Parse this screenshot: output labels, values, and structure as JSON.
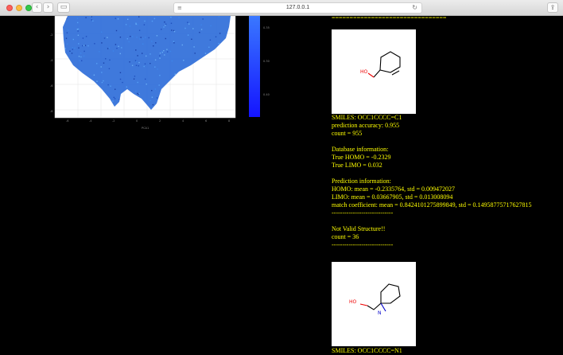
{
  "browser": {
    "url": "127.0.0.1",
    "back_glyph": "‹",
    "forward_glyph": "›",
    "reload_glyph": "↻",
    "share_glyph": "⇪",
    "sidebar_glyph": "▭",
    "reader_glyph": "≡"
  },
  "plot": {
    "colorbar_ticks": [
      "0.35",
      "0.30",
      "0.25",
      "0.40"
    ],
    "colorbar_tick_values": [
      0.35,
      0.3,
      0.25,
      0.4
    ],
    "x_ticks": [
      "-6",
      "-4",
      "-2",
      "0",
      "2",
      "4",
      "6",
      "8"
    ],
    "y_ticks": [
      "-2",
      "-4",
      "-6",
      "-8"
    ],
    "xlabel": "PCA1",
    "colors": {
      "scatter": "#1f5fd0",
      "colorbar_top": "#2f6fff",
      "colorbar_bottom": "#1a1aff"
    }
  },
  "results": {
    "top_separator": "================================",
    "molecule_1": {
      "hetero_label": "HO",
      "smiles": "SMILES: OCC1CCCC=C1",
      "accuracy": "prediction accuracy: 0.955",
      "count": "count = 955",
      "db_header": "Database information:",
      "true_homo": "True HOMO = -0.2329",
      "true_limo": "True LIMO = 0.032",
      "pred_header": "Prediction information:",
      "homo": "HOMO: mean = -0.2335764, std = 0.009472027",
      "limo": "LIMO: mean = 0.03667905, std = 0.013008094",
      "match": "match coefficient: mean = 0.8424101275899849, std = 0.14958775717627815",
      "separator": "-----------------------------"
    },
    "invalid": {
      "title": "Not Valid Structure!!",
      "count": "count = 36",
      "separator": "-----------------------------"
    },
    "molecule_2": {
      "hetero_label": "HO",
      "n_label": "N",
      "smiles": "SMILES: OCC1CCCC=N1"
    }
  }
}
